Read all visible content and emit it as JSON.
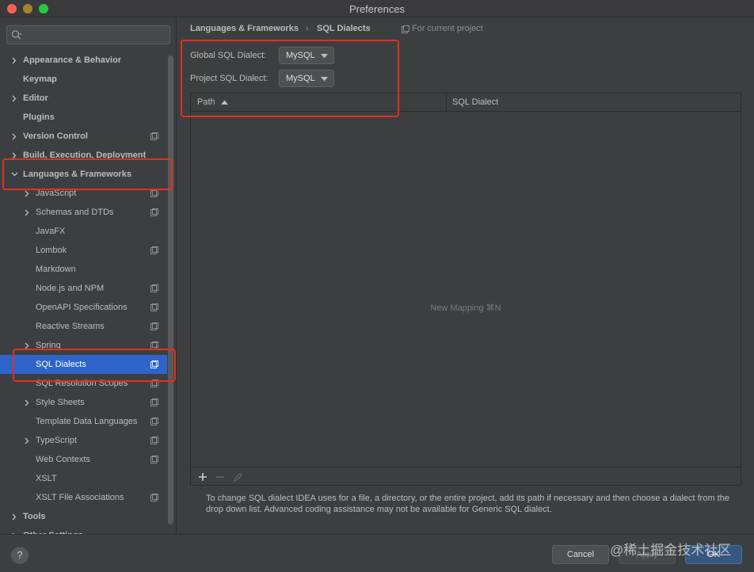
{
  "window": {
    "title": "Preferences"
  },
  "sidebar": {
    "search_placeholder": "",
    "items": [
      {
        "label": "Appearance & Behavior",
        "chevron": "right",
        "bold": true
      },
      {
        "label": "Keymap",
        "chevron": "none",
        "bold": true
      },
      {
        "label": "Editor",
        "chevron": "right",
        "bold": true
      },
      {
        "label": "Plugins",
        "chevron": "none",
        "bold": true
      },
      {
        "label": "Version Control",
        "chevron": "right",
        "bold": true,
        "project_icon": true
      },
      {
        "label": "Build, Execution, Deployment",
        "chevron": "right",
        "bold": true
      },
      {
        "label": "Languages & Frameworks",
        "chevron": "down",
        "bold": true
      },
      {
        "label": "JavaScript",
        "chevron": "right",
        "project_icon": true
      },
      {
        "label": "Schemas and DTDs",
        "chevron": "right",
        "project_icon": true
      },
      {
        "label": "JavaFX",
        "chevron": "none"
      },
      {
        "label": "Lombok",
        "chevron": "none",
        "project_icon": true
      },
      {
        "label": "Markdown",
        "chevron": "none"
      },
      {
        "label": "Node.js and NPM",
        "chevron": "none",
        "project_icon": true
      },
      {
        "label": "OpenAPI Specifications",
        "chevron": "none",
        "project_icon": true
      },
      {
        "label": "Reactive Streams",
        "chevron": "none",
        "project_icon": true
      },
      {
        "label": "Spring",
        "chevron": "right",
        "project_icon": true
      },
      {
        "label": "SQL Dialects",
        "chevron": "none",
        "project_icon": true,
        "selected": true
      },
      {
        "label": "SQL Resolution Scopes",
        "chevron": "none",
        "project_icon": true
      },
      {
        "label": "Style Sheets",
        "chevron": "right",
        "project_icon": true
      },
      {
        "label": "Template Data Languages",
        "chevron": "none",
        "project_icon": true
      },
      {
        "label": "TypeScript",
        "chevron": "right",
        "project_icon": true
      },
      {
        "label": "Web Contexts",
        "chevron": "none",
        "project_icon": true
      },
      {
        "label": "XSLT",
        "chevron": "none"
      },
      {
        "label": "XSLT File Associations",
        "chevron": "none",
        "project_icon": true
      },
      {
        "label": "Tools",
        "chevron": "right",
        "bold": true
      },
      {
        "label": "Other Settings",
        "chevron": "right",
        "bold": true
      }
    ]
  },
  "main": {
    "breadcrumb": {
      "parent": "Languages & Frameworks",
      "separator": "›",
      "current": "SQL Dialects"
    },
    "scope_label": "For current project",
    "global_dialect": {
      "label": "Global SQL Dialect:",
      "value": "MySQL"
    },
    "project_dialect": {
      "label": "Project SQL Dialect:",
      "value": "MySQL"
    },
    "table": {
      "columns": [
        "Path",
        "SQL Dialect"
      ],
      "empty_text": "New Mapping ⌘N"
    },
    "toolbar": {
      "add": "+",
      "remove": "−"
    },
    "help_text": "To change SQL dialect IDEA uses for a file, a directory, or the entire project, add its path if necessary and then choose a dialect from the drop down list. Advanced coding assistance may not be available for Generic SQL dialect."
  },
  "footer": {
    "help": "?",
    "cancel": "Cancel",
    "apply": "Apply",
    "ok": "OK"
  },
  "watermark": "@稀土掘金技术社区",
  "colors": {
    "background": "#3c3f41",
    "selection": "#2f65ca",
    "annotation": "#e0311a",
    "ok_button": "#365880"
  }
}
